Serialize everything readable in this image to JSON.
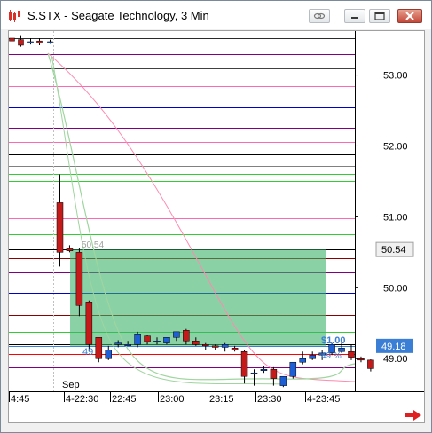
{
  "window": {
    "title": "S.STX - Seagate Technology, 3 Min"
  },
  "icons": {
    "app": "chart-candle-icon",
    "link": "link-icon",
    "minimize": "minimize-icon",
    "restore": "restore-icon",
    "close": "close-icon",
    "scroll_right": "red-arrow-right-icon"
  },
  "chart_data": {
    "type": "candlestick",
    "symbol": "S.STX",
    "name": "Seagate Technology",
    "interval": "3 Min",
    "y_ticks": [
      "53.00",
      "52.00",
      "51.00",
      "50.00",
      "49.00"
    ],
    "ylim": [
      48.6,
      53.6
    ],
    "x_ticks": [
      "4:45",
      "4-22:30",
      "22:45",
      "23:00",
      "23:15",
      "23:30",
      "4-23:45"
    ],
    "month_label": "Sep",
    "last_price_label": "50.54",
    "current_price_label": "49.18",
    "price_annotation": "50.54",
    "position_pnl_label": "$1.00",
    "position_pct_label": "49 %",
    "position_left_label": "49",
    "candles_left_session": [
      {
        "o": 53.52,
        "h": 53.6,
        "l": 53.45,
        "c": 53.48
      },
      {
        "o": 53.5,
        "h": 53.55,
        "l": 53.4,
        "c": 53.42
      },
      {
        "o": 53.47,
        "h": 53.52,
        "l": 53.43,
        "c": 53.47
      },
      {
        "o": 53.48,
        "h": 53.52,
        "l": 53.42,
        "c": 53.45
      },
      {
        "o": 53.47,
        "h": 53.5,
        "l": 53.44,
        "c": 53.47
      }
    ],
    "candles": [
      {
        "o": 51.2,
        "h": 51.6,
        "l": 50.3,
        "c": 50.5
      },
      {
        "o": 50.55,
        "h": 50.6,
        "l": 50.5,
        "c": 50.52
      },
      {
        "o": 50.5,
        "h": 50.56,
        "l": 49.6,
        "c": 49.75
      },
      {
        "o": 49.8,
        "h": 49.82,
        "l": 49.1,
        "c": 49.2
      },
      {
        "o": 49.3,
        "h": 49.3,
        "l": 48.95,
        "c": 49.0
      },
      {
        "o": 49.0,
        "h": 49.18,
        "l": 48.98,
        "c": 49.12
      },
      {
        "o": 49.2,
        "h": 49.26,
        "l": 49.16,
        "c": 49.22
      },
      {
        "o": 49.2,
        "h": 49.25,
        "l": 49.18,
        "c": 49.2
      },
      {
        "o": 49.2,
        "h": 49.38,
        "l": 49.16,
        "c": 49.35
      },
      {
        "o": 49.32,
        "h": 49.34,
        "l": 49.2,
        "c": 49.24
      },
      {
        "o": 49.25,
        "h": 49.3,
        "l": 49.2,
        "c": 49.25
      },
      {
        "o": 49.22,
        "h": 49.3,
        "l": 49.2,
        "c": 49.3
      },
      {
        "o": 49.3,
        "h": 49.38,
        "l": 49.25,
        "c": 49.38
      },
      {
        "o": 49.4,
        "h": 49.42,
        "l": 49.2,
        "c": 49.25
      },
      {
        "o": 49.25,
        "h": 49.3,
        "l": 49.18,
        "c": 49.2
      },
      {
        "o": 49.2,
        "h": 49.22,
        "l": 49.12,
        "c": 49.18
      },
      {
        "o": 49.18,
        "h": 49.2,
        "l": 49.12,
        "c": 49.16
      },
      {
        "o": 49.16,
        "h": 49.22,
        "l": 49.1,
        "c": 49.2
      },
      {
        "o": 49.15,
        "h": 49.18,
        "l": 49.1,
        "c": 49.12
      },
      {
        "o": 49.1,
        "h": 49.12,
        "l": 48.65,
        "c": 48.75
      },
      {
        "o": 48.8,
        "h": 48.85,
        "l": 48.62,
        "c": 48.8
      },
      {
        "o": 48.85,
        "h": 48.9,
        "l": 48.8,
        "c": 48.85
      },
      {
        "o": 48.85,
        "h": 48.88,
        "l": 48.62,
        "c": 48.72
      },
      {
        "o": 48.62,
        "h": 48.75,
        "l": 48.6,
        "c": 48.75
      },
      {
        "o": 48.75,
        "h": 48.95,
        "l": 48.72,
        "c": 48.95
      },
      {
        "o": 48.95,
        "h": 49.1,
        "l": 48.92,
        "c": 49.0
      },
      {
        "o": 49.0,
        "h": 49.1,
        "l": 48.98,
        "c": 49.05
      },
      {
        "o": 49.05,
        "h": 49.12,
        "l": 48.98,
        "c": 49.08
      },
      {
        "o": 49.08,
        "h": 49.22,
        "l": 49.05,
        "c": 49.2
      },
      {
        "o": 49.1,
        "h": 49.25,
        "l": 49.08,
        "c": 49.15
      },
      {
        "o": 49.1,
        "h": 49.2,
        "l": 48.98,
        "c": 49.02
      },
      {
        "o": 49.0,
        "h": 49.03,
        "l": 48.95,
        "c": 48.98
      },
      {
        "o": 48.98,
        "h": 48.99,
        "l": 48.82,
        "c": 48.86
      }
    ],
    "levels": [
      {
        "y": 53.52,
        "color": "#2a2a2a"
      },
      {
        "y": 53.3,
        "color": "#800080"
      },
      {
        "y": 53.1,
        "color": "#404040"
      },
      {
        "y": 52.85,
        "color": "#ff69b4"
      },
      {
        "y": 52.55,
        "color": "#0000cd"
      },
      {
        "y": 52.25,
        "color": "#800080"
      },
      {
        "y": 52.05,
        "color": "#ff69b4"
      },
      {
        "y": 51.88,
        "color": "#000000"
      },
      {
        "y": 51.72,
        "color": "#808080"
      },
      {
        "y": 51.6,
        "color": "#32cd32"
      },
      {
        "y": 51.5,
        "color": "#32cd32"
      },
      {
        "y": 51.23,
        "color": "#a0a0a0"
      },
      {
        "y": 50.98,
        "color": "#ff69b4"
      },
      {
        "y": 50.9,
        "color": "#ff69b4"
      },
      {
        "y": 50.75,
        "color": "#32cd32"
      },
      {
        "y": 50.54,
        "color": "#000000"
      },
      {
        "y": 50.42,
        "color": "#8b0000"
      },
      {
        "y": 50.22,
        "color": "#800080"
      },
      {
        "y": 49.93,
        "color": "#0000cd"
      },
      {
        "y": 49.62,
        "color": "#8b0000"
      },
      {
        "y": 49.38,
        "color": "#32cd32"
      },
      {
        "y": 49.2,
        "color": "#000000"
      },
      {
        "y": 49.18,
        "color": "#3a7fd5"
      },
      {
        "y": 49.07,
        "color": "#ff0000"
      },
      {
        "y": 48.88,
        "color": "#800080"
      },
      {
        "y": 48.57,
        "color": "#0000cd"
      }
    ],
    "colors": {
      "up": "#1e5fd6",
      "down": "#c41a1a",
      "zone_fill": "#3cb36a",
      "zone_opacity": 0.6,
      "trend_line_pink": "#ff8ab0",
      "trend_line_green": "#9fd59f"
    }
  }
}
